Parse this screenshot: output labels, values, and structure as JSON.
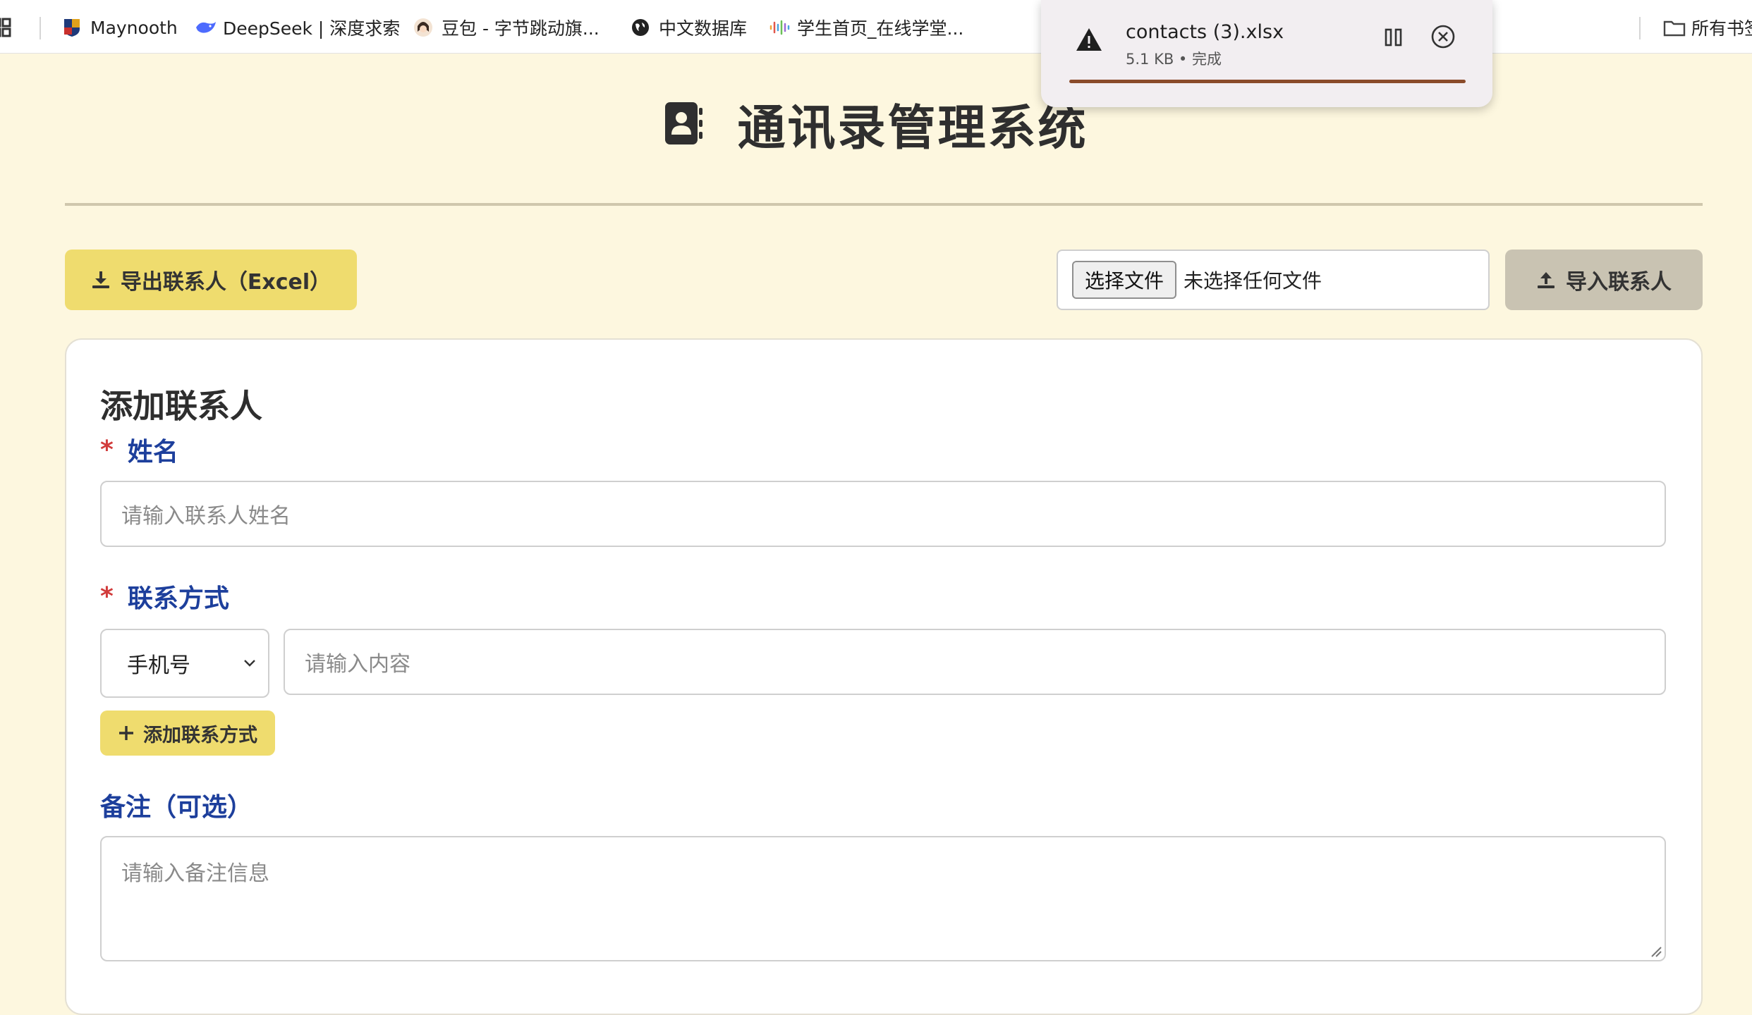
{
  "bookmarks": [
    {
      "label": "Maynooth",
      "icon": "maynooth-crest-icon"
    },
    {
      "label": "DeepSeek | 深度求索",
      "icon": "deepseek-whale-icon"
    },
    {
      "label": "豆包 - 字节跳动旗...",
      "icon": "doubao-avatar-icon"
    },
    {
      "label": "中文数据库",
      "icon": "globe-icon"
    },
    {
      "label": "学生首页_在线学堂...",
      "icon": "audio-wave-icon"
    }
  ],
  "all_bookmarks_label": "所有书签",
  "page": {
    "title": "通讯录管理系统",
    "export_label": "导出联系人（Excel）",
    "file_button_label": "选择文件",
    "file_status": "未选择任何文件",
    "import_label": "导入联系人"
  },
  "form": {
    "heading": "添加联系人",
    "name_label": "姓名",
    "name_placeholder": "请输入联系人姓名",
    "contact_label": "联系方式",
    "contact_type": "手机号",
    "contact_placeholder": "请输入内容",
    "add_contact_label": "添加联系方式",
    "note_label": "备注（可选）",
    "note_placeholder": "请输入备注信息",
    "required_marker": "*"
  },
  "download": {
    "filename": "contacts (3).xlsx",
    "meta": "5.1 KB • 完成",
    "progress": 1.0
  },
  "colors": {
    "background": "#fdf7df",
    "accent_yellow": "#efdc6e",
    "label_blue": "#1d3f9c",
    "required_red": "#d13b3b"
  }
}
